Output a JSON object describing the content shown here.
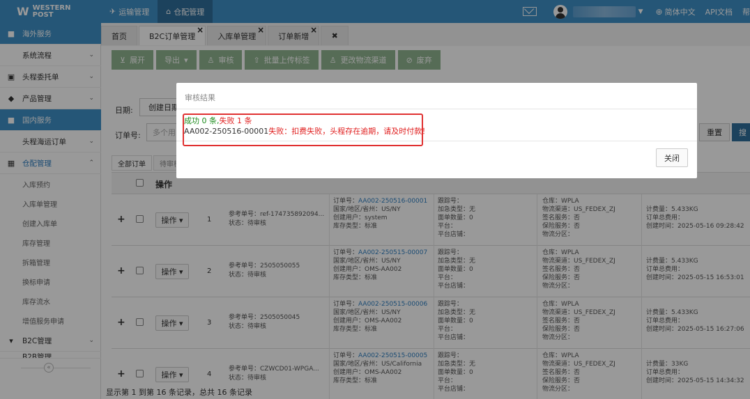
{
  "brand": {
    "logo_line1": "WESTERN",
    "logo_line2": "POST"
  },
  "topnav": [
    {
      "label": "运输管理",
      "active": false
    },
    {
      "label": "仓配管理",
      "active": true
    }
  ],
  "topright": {
    "language": "简体中文",
    "api_docs": "API文档",
    "help": "帮"
  },
  "sidebar": {
    "groups": [
      {
        "label": "海外服务",
        "highlight": true
      },
      {
        "label": "系统流程"
      },
      {
        "label": "头程委托单"
      },
      {
        "label": "产品管理"
      },
      {
        "label": "国内服务",
        "highlight": true
      },
      {
        "label": "头程海运订单"
      },
      {
        "label": "仓配管理",
        "expanded": true
      }
    ],
    "sub_items": [
      "入库预约",
      "入库单管理",
      "创建入库单",
      "库存管理",
      "拆箱管理",
      "换标申请",
      "库存流水",
      "增值服务申请"
    ],
    "bottom": [
      "B2C管理",
      "B2B管理"
    ],
    "collapse_symbol": "«"
  },
  "tabs": [
    {
      "label": "首页",
      "closable": false
    },
    {
      "label": "B2C订单管理",
      "closable": true,
      "active": true
    },
    {
      "label": "入库单管理",
      "closable": true
    },
    {
      "label": "订单新增",
      "closable": true
    },
    {
      "label": "",
      "closable": true
    }
  ],
  "toolbar": [
    {
      "label": "展开",
      "icon": "expand-icon"
    },
    {
      "label": "导出",
      "icon": "caret-icon"
    },
    {
      "label": "审核",
      "icon": "user-icon"
    },
    {
      "label": "批量上传标签",
      "icon": "upload-icon"
    },
    {
      "label": "更改物流渠道",
      "icon": "user-icon"
    },
    {
      "label": "废弃",
      "icon": "ban-icon"
    }
  ],
  "filters": {
    "date_label": "日期:",
    "date_select": "创建日期",
    "order_label": "订单号:",
    "order_placeholder": "多个用",
    "reset": "重置",
    "search": "搜"
  },
  "subtabs": [
    "全部订单",
    "待审核"
  ],
  "table_header": {
    "operate": "操作"
  },
  "rows": [
    {
      "idx": "1",
      "ref": "参考单号：ref-174735892094...",
      "status": "状态：待审核",
      "order_no": "AA002-250516-00001",
      "country": "国家/地区/省州：US/NY",
      "creator": "创建用户：system",
      "stock_type": "库存类型：标准",
      "tracking": "跟踪号：",
      "addon": "加急类型：无",
      "weight_count": "面单数量：0",
      "platform": "平台：",
      "shop": "平台店铺：",
      "warehouse": "仓库：WPLA",
      "channel": "物流渠道：US_FEDEX_ZJ",
      "sign": "签名服务：否",
      "insure": "保险服务：否",
      "zone": "物流分区：",
      "weight": "计费量：5.433KG",
      "fee": "订单总费用：",
      "created": "创建时间：2025-05-16 09:28:42"
    },
    {
      "idx": "2",
      "ref": "参考单号：2505050055",
      "status": "状态：待审核",
      "order_no": "AA002-250515-00007",
      "country": "国家/地区/省州：US/NY",
      "creator": "创建用户：OMS-AA002",
      "stock_type": "库存类型：标准",
      "tracking": "跟踪号：",
      "addon": "加急类型：无",
      "weight_count": "面单数量：0",
      "platform": "平台：",
      "shop": "平台店铺：",
      "warehouse": "仓库：WPLA",
      "channel": "物流渠道：US_FEDEX_ZJ",
      "sign": "签名服务：否",
      "insure": "保险服务：否",
      "zone": "物流分区：",
      "weight": "计费量：5.433KG",
      "fee": "订单总费用：",
      "created": "创建时间：2025-05-15 16:53:01"
    },
    {
      "idx": "3",
      "ref": "参考单号：2505050045",
      "status": "状态：待审核",
      "order_no": "AA002-250515-00006",
      "country": "国家/地区/省州：US/NY",
      "creator": "创建用户：OMS-AA002",
      "stock_type": "库存类型：标准",
      "tracking": "跟踪号：",
      "addon": "加急类型：无",
      "weight_count": "面单数量：0",
      "platform": "平台：",
      "shop": "平台店铺：",
      "warehouse": "仓库：WPLA",
      "channel": "物流渠道：US_FEDEX_ZJ",
      "sign": "签名服务：否",
      "insure": "保险服务：否",
      "zone": "物流分区：",
      "weight": "计费量：5.433KG",
      "fee": "订单总费用：",
      "created": "创建时间：2025-05-15 16:27:06"
    },
    {
      "idx": "4",
      "ref": "参考单号：CZWCD01-WPGA...",
      "status": "状态：待审核",
      "order_no": "AA002-250515-00005",
      "country": "国家/地区/省州：US/California",
      "creator": "创建用户：OMS-AA002",
      "stock_type": "库存类型：标准",
      "tracking": "跟踪号：",
      "addon": "加急类型：无",
      "weight_count": "面单数量：0",
      "platform": "平台：",
      "shop": "平台店铺：",
      "warehouse": "仓库：WPLA",
      "channel": "物流渠道：US_FEDEX_ZJ",
      "sign": "签名服务：否",
      "insure": "保险服务：否",
      "zone": "物流分区：",
      "weight": "计费量：33KG",
      "fee": "订单总费用：",
      "created": "创建时间：2025-05-15 14:34:32"
    }
  ],
  "row_labels": {
    "order_no_prefix": "订单号：",
    "op_button": "操作"
  },
  "footer": "显示第 1 到第 16 条记录，总共 16 条记录",
  "modal": {
    "title": "审核结果",
    "success": "成功 0 条,",
    "fail": "失败 1 条",
    "detail_order": "AA002-250516-00001",
    "detail_msg": "失败：扣费失败，头程存在逾期，请及时付款！",
    "close": "关闭"
  },
  "colors": {
    "brand_blue": "#3e8fc7",
    "dark_blue": "#2f6e9c",
    "toolbar_green": "#8fb58f",
    "success_green": "#1a8a1a",
    "error_red": "#e02020"
  }
}
